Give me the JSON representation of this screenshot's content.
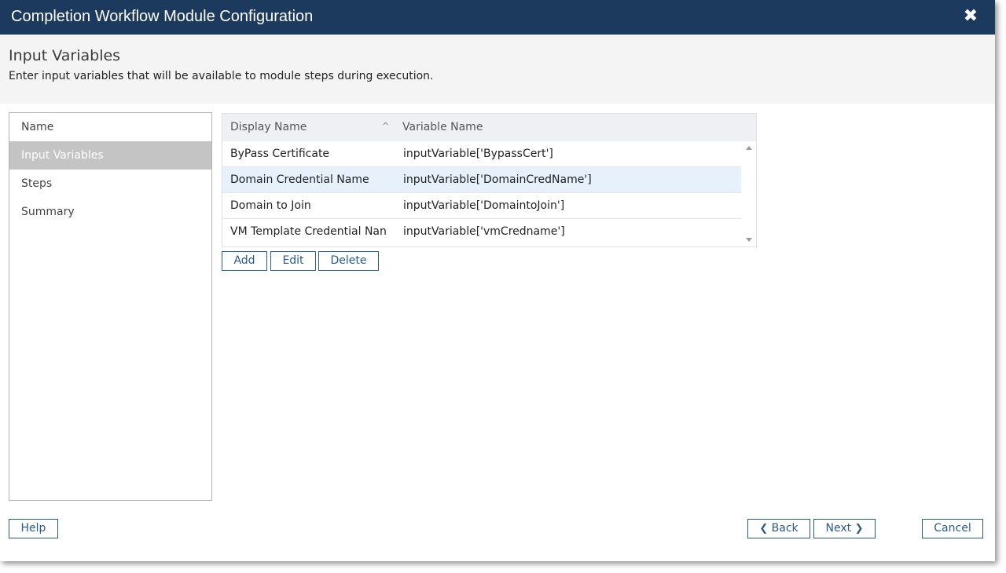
{
  "window": {
    "title": "Completion Workflow Module Configuration",
    "close_icon": "close-icon",
    "header_color": "#1b3a5e"
  },
  "page": {
    "title": "Input Variables",
    "subtitle": "Enter input variables that will be available to module steps during execution."
  },
  "sidenav": {
    "items": [
      {
        "label": "Name",
        "active": false
      },
      {
        "label": "Input Variables",
        "active": true
      },
      {
        "label": "Steps",
        "active": false
      },
      {
        "label": "Summary",
        "active": false
      }
    ]
  },
  "grid": {
    "columns": [
      {
        "label": "Display Name",
        "sort": "ascending"
      },
      {
        "label": "Variable Name"
      }
    ],
    "rows": [
      {
        "display_name": "ByPass Certificate",
        "variable_name": "inputVariable['BypassCert']",
        "selected": false
      },
      {
        "display_name": "Domain Credential Name",
        "variable_name": "inputVariable['DomainCredName']",
        "selected": true
      },
      {
        "display_name": "Domain to Join",
        "variable_name": "inputVariable['DomaintoJoin']",
        "selected": false
      },
      {
        "display_name": "VM Template Credential Nan",
        "variable_name": "inputVariable['vmCredname']",
        "selected": false
      }
    ]
  },
  "grid_actions": {
    "add": "Add",
    "edit": "Edit",
    "delete": "Delete"
  },
  "footer": {
    "help": "Help",
    "back": "Back",
    "next": "Next",
    "cancel": "Cancel"
  },
  "colors": {
    "accent": "#2a5a8a",
    "selected_row": "#e6f1fb",
    "active_nav": "#c4c4c4"
  }
}
